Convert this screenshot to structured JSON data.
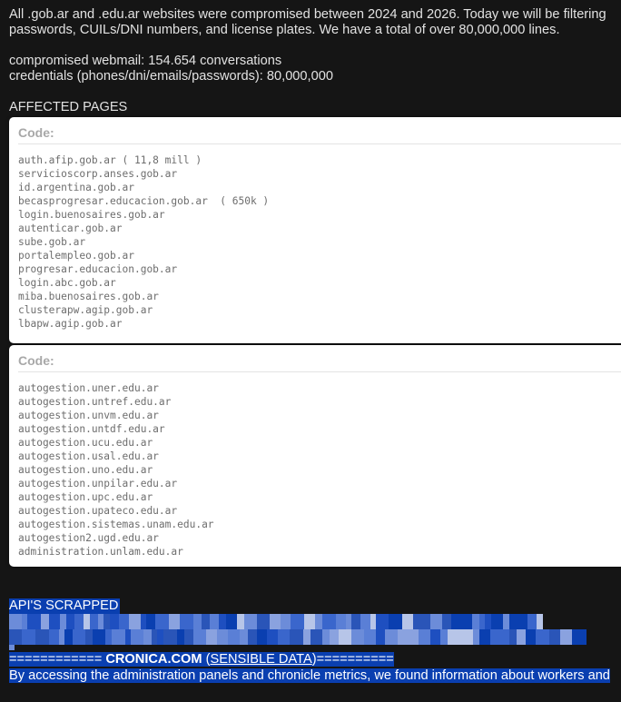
{
  "intro": {
    "line1": "All .gob.ar and .edu.ar websites were compromised between 2024 and 2026. Today we will be filtering",
    "line2": "passwords, CUILs/DNI numbers, and license plates. We have a total of over 80,000,000 lines.",
    "stat1": "compromised webmail: 154.654 conversations",
    "stat2": "credentials (phones/dni/emails/passwords): 80,000,000"
  },
  "affected_title": "AFFECTED PAGES",
  "code_box_1": {
    "header": "Code:",
    "lines": [
      "auth.afip.gob.ar ( 11,8 mill )",
      "servicioscorp.anses.gob.ar",
      "id.argentina.gob.ar",
      "becasprogresar.educacion.gob.ar  ( 650k )",
      "login.buenosaires.gob.ar",
      "autenticar.gob.ar",
      "sube.gob.ar",
      "portalempleo.gob.ar",
      "progresar.educacion.gob.ar",
      "login.abc.gob.ar",
      "miba.buenosaires.gob.ar",
      "clusterapw.agip.gob.ar",
      "lbapw.agip.gob.ar"
    ]
  },
  "code_box_2": {
    "header": "Code:",
    "lines": [
      "autogestion.uner.edu.ar",
      "autogestion.untref.edu.ar",
      "autogestion.unvm.edu.ar",
      "autogestion.untdf.edu.ar",
      "autogestion.ucu.edu.ar",
      "autogestion.usal.edu.ar",
      "autogestion.uno.edu.ar",
      "autogestion.unpilar.edu.ar",
      "autogestion.upc.edu.ar",
      "autogestion.upateco.edu.ar",
      "autogestion.sistemas.unam.edu.ar",
      "autogestion2.ugd.edu.ar",
      "administration.unlam.edu.ar"
    ]
  },
  "api": {
    "title": "API'S SCRAPPED",
    "cronica_prefix": "============",
    "cronica_brand": "CRONICA.COM",
    "cronica_open": "(",
    "cronica_sensible": "SENSIBLE DATA",
    "cronica_close": ")==========",
    "last_line": "By accessing the administration panels and chronicle metrics, we found information about workers and"
  },
  "colors": {
    "background": "#151515",
    "text": "#e2e2e2",
    "highlight": "#0a3fb0",
    "code_text": "#6d6d6d",
    "code_header": "#a8a8a8"
  }
}
